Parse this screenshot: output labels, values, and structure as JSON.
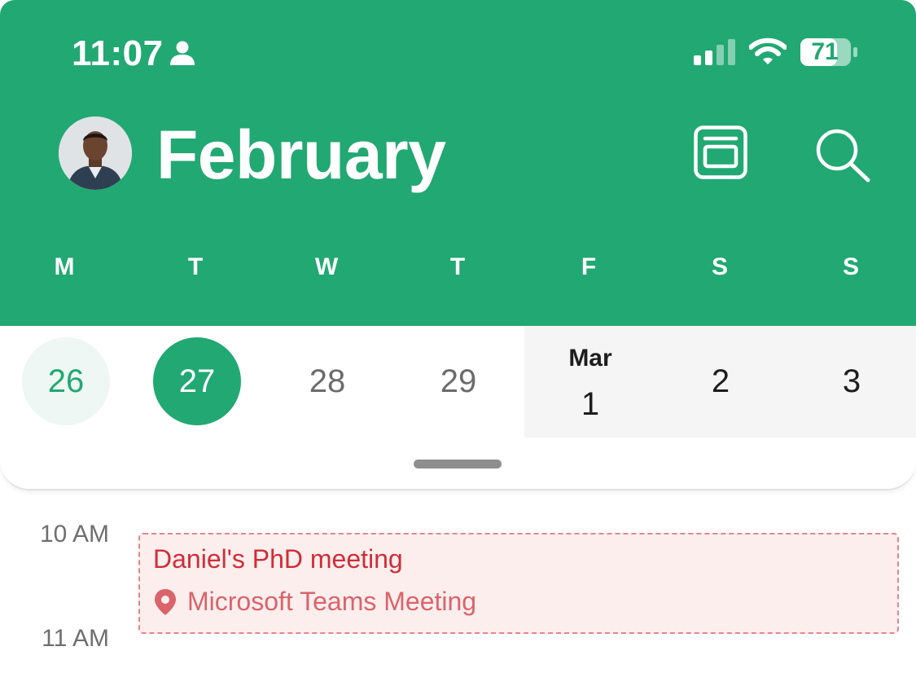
{
  "status_bar": {
    "time": "11:07",
    "battery": "71"
  },
  "header": {
    "month_title": "February",
    "weekdays": [
      "M",
      "T",
      "W",
      "T",
      "F",
      "S",
      "S"
    ]
  },
  "date_strip": {
    "days": [
      {
        "label": "26",
        "state": "today"
      },
      {
        "label": "27",
        "state": "selected"
      },
      {
        "label": "28",
        "state": "normal"
      },
      {
        "label": "29",
        "state": "normal"
      },
      {
        "month": "Mar",
        "label": "1",
        "state": "next-month"
      },
      {
        "label": "2",
        "state": "next-month"
      },
      {
        "label": "3",
        "state": "next-month"
      }
    ]
  },
  "agenda": {
    "time_labels": [
      "10 AM",
      "11 AM"
    ],
    "event": {
      "title": "Daniel's PhD meeting",
      "location": "Microsoft Teams Meeting"
    }
  },
  "colors": {
    "brand_green": "#22a873",
    "event_red": "#cf2e37",
    "event_bg": "#fdeeee"
  }
}
